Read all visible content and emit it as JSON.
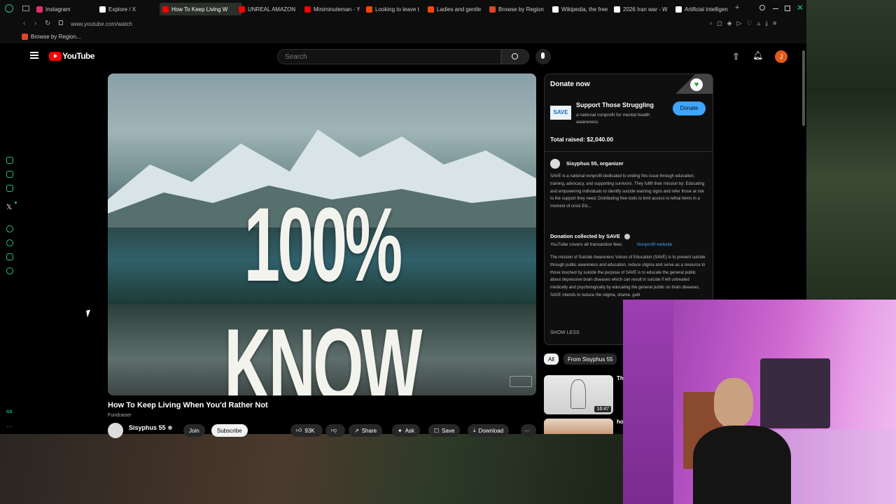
{
  "browser": {
    "tabs": [
      {
        "label": "Instagram",
        "color": "#e1306c"
      },
      {
        "label": "Explore / X",
        "color": "#ffffff"
      },
      {
        "label": "How To Keep Living W",
        "color": "#ff0000",
        "active": true
      },
      {
        "label": "UNREAL AMAZON",
        "color": "#ff0000"
      },
      {
        "label": "Miniminuteman - Y",
        "color": "#ff0000"
      },
      {
        "label": "Looking to leave t",
        "color": "#ff4500"
      },
      {
        "label": "Ladies and gentle",
        "color": "#ff4500"
      },
      {
        "label": "Browse by Region",
        "color": "#e0452b"
      },
      {
        "label": "Wikipedia, the free",
        "color": "#ffffff"
      },
      {
        "label": "2026 Iran war - W",
        "color": "#ffffff"
      },
      {
        "label": "Artificial intelligen",
        "color": "#ffffff"
      }
    ],
    "url": "www.youtube.com/watch",
    "bookmark": "Browse by Region..."
  },
  "youtube": {
    "logo": "YouTube",
    "search_placeholder": "Search",
    "avatar_letter": "J"
  },
  "video": {
    "overlay_text": "100% KNOW",
    "title": "How To Keep Living When You'd Rather Not",
    "fundraiser_tag": "Fundraiser",
    "channel": "Sisyphus 55",
    "join_label": "Join",
    "subscribe_label": "Subscribe",
    "likes": "93K",
    "share_label": "Share",
    "ask_label": "Ask",
    "save_label": "Save",
    "download_label": "Download"
  },
  "donation": {
    "header": "Donate now",
    "campaign_title": "Support Those Struggling",
    "campaign_sub": "a national nonprofit for mental health awareness",
    "donate_button": "Donate",
    "total_raised": "Total raised: $2,040.00",
    "organizer": "Sisyphus 55, organizer",
    "organizer_text": "SAVE is a national nonprofit dedicated to ending this issue through education, training, advocacy, and supporting survivors. They fulfill their mission by: Educating and empowering individuals to identify suicide warning signs and refer those at risk to the support they need; Distributing free tools to limit access to lethal items in a moment of crisis Etc...",
    "collected_by": "Donation collected by SAVE",
    "fees_note": "YouTube covers all transaction fees",
    "nonprofit_link": "Nonprofit website",
    "mission_text": "The mission of Suicide Awareness Voices of Education (SAVE) is to prevent suicide through public awareness and education, reduce stigma and serve as a resource to those touched by suicide the purpose of SAVE is to educate the general public about depressive brain diseases which can result in suicide if left untreated medically and psychologically by educating the general public on brain diseases, SAVE intends to reduce the stigma, shame, guilt",
    "show_less": "SHOW LESS",
    "logo_text": "SAVE"
  },
  "recommendations": {
    "chips": [
      "All",
      "From Sisyphus 55"
    ],
    "items": [
      {
        "title_partial": "Th",
        "duration": "16:47"
      },
      {
        "title_partial": "ho",
        "duration": ""
      }
    ]
  }
}
